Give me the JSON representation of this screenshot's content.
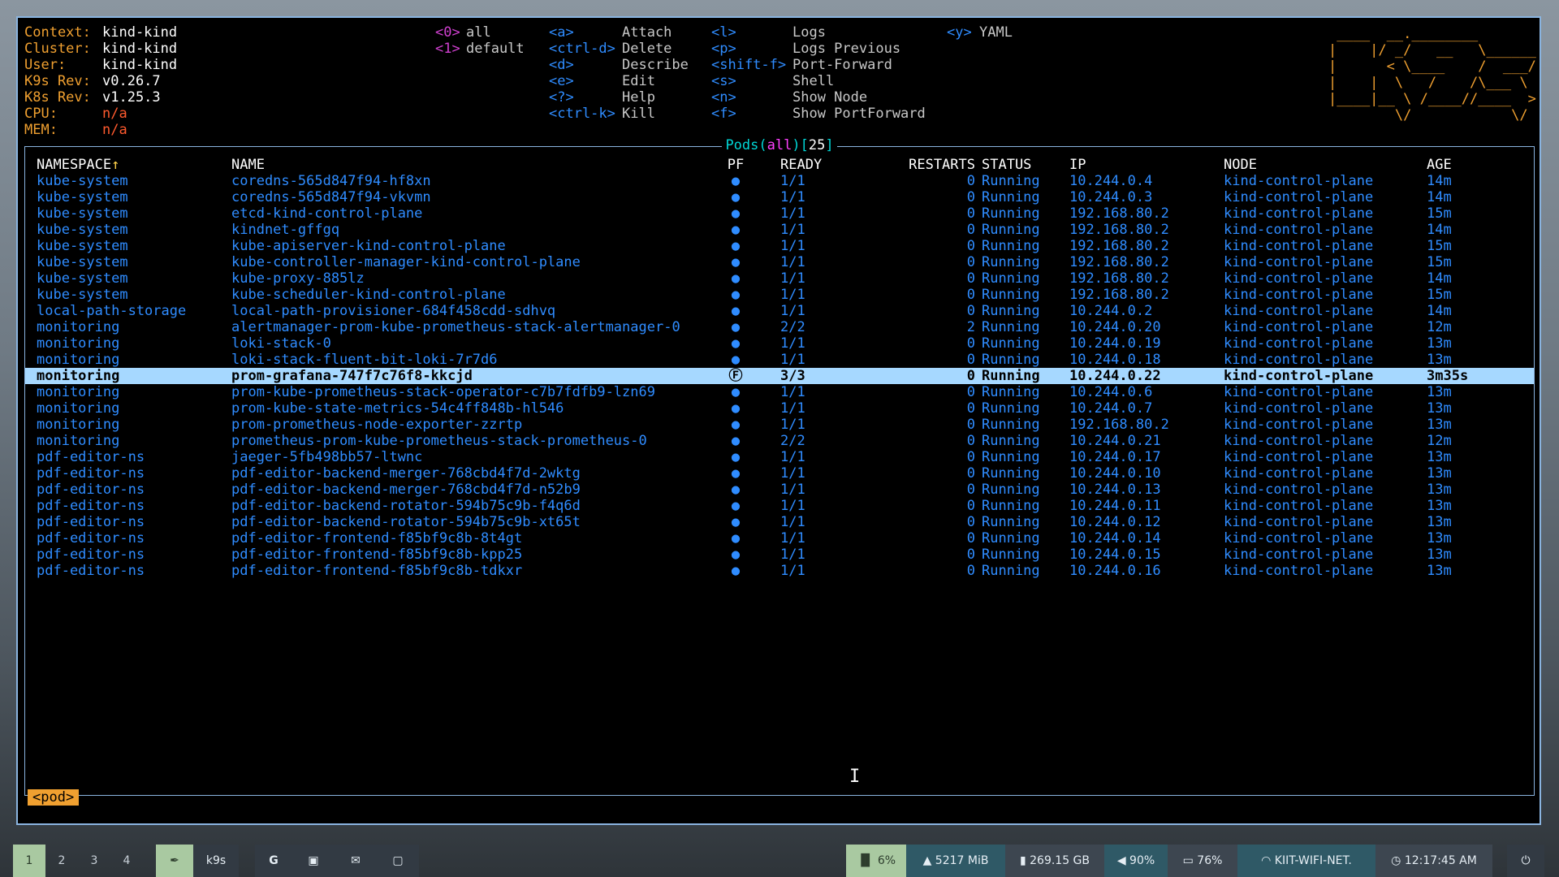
{
  "app": "k9s",
  "info": {
    "context_label": "Context:",
    "context": "kind-kind",
    "cluster_label": "Cluster:",
    "cluster": "kind-kind",
    "user_label": "User:",
    "user": "kind-kind",
    "k9s_rev_label": "K9s Rev:",
    "k9s_rev": "v0.26.7",
    "k8s_rev_label": "K8s Rev:",
    "k8s_rev": "v1.25.3",
    "cpu_label": "CPU:",
    "cpu": "n/a",
    "mem_label": "MEM:",
    "mem": "n/a"
  },
  "namespaces": [
    {
      "key": "<0>",
      "label": "all"
    },
    {
      "key": "<1>",
      "label": "default"
    }
  ],
  "shortcuts_col1": [
    {
      "key": "<a>",
      "label": "Attach"
    },
    {
      "key": "<ctrl-d>",
      "label": "Delete"
    },
    {
      "key": "<d>",
      "label": "Describe"
    },
    {
      "key": "<e>",
      "label": "Edit"
    },
    {
      "key": "<?>",
      "label": "Help"
    },
    {
      "key": "<ctrl-k>",
      "label": "Kill"
    }
  ],
  "shortcuts_col2": [
    {
      "key": "<l>",
      "label": "Logs"
    },
    {
      "key": "<p>",
      "label": "Logs Previous"
    },
    {
      "key": "<shift-f>",
      "label": "Port-Forward"
    },
    {
      "key": "<s>",
      "label": "Shell"
    },
    {
      "key": "<n>",
      "label": "Show Node"
    },
    {
      "key": "<f>",
      "label": "Show PortForward"
    }
  ],
  "shortcuts_col3": [
    {
      "key": "<y>",
      "label": "YAML"
    }
  ],
  "logo_lines": [
    " ____  __.________       ",
    "|    |/ _/   __   \\______",
    "|      < \\____    /  ___/",
    "|    |  \\   /    /\\___ \\ ",
    "|____|__ \\ /____//____  >",
    "        \\/            \\/ "
  ],
  "table": {
    "title_prefix": "Pods(",
    "title_ns": "all",
    "title_mid": ")[",
    "title_count": "25",
    "title_suffix": "]",
    "sort_arrow": "↑",
    "headers": {
      "ns": "NAMESPACE",
      "name": "NAME",
      "pf": "PF",
      "ready": "READY",
      "restarts": "RESTARTS",
      "status": "STATUS",
      "ip": "IP",
      "node": "NODE",
      "age": "AGE"
    },
    "rows": [
      {
        "ns": "kube-system",
        "name": "coredns-565d847f94-hf8xn",
        "pf": "●",
        "ready": "1/1",
        "restarts": "0",
        "status": "Running",
        "ip": "10.244.0.4",
        "node": "kind-control-plane",
        "age": "14m"
      },
      {
        "ns": "kube-system",
        "name": "coredns-565d847f94-vkvmn",
        "pf": "●",
        "ready": "1/1",
        "restarts": "0",
        "status": "Running",
        "ip": "10.244.0.3",
        "node": "kind-control-plane",
        "age": "14m"
      },
      {
        "ns": "kube-system",
        "name": "etcd-kind-control-plane",
        "pf": "●",
        "ready": "1/1",
        "restarts": "0",
        "status": "Running",
        "ip": "192.168.80.2",
        "node": "kind-control-plane",
        "age": "15m"
      },
      {
        "ns": "kube-system",
        "name": "kindnet-gffgq",
        "pf": "●",
        "ready": "1/1",
        "restarts": "0",
        "status": "Running",
        "ip": "192.168.80.2",
        "node": "kind-control-plane",
        "age": "14m"
      },
      {
        "ns": "kube-system",
        "name": "kube-apiserver-kind-control-plane",
        "pf": "●",
        "ready": "1/1",
        "restarts": "0",
        "status": "Running",
        "ip": "192.168.80.2",
        "node": "kind-control-plane",
        "age": "15m"
      },
      {
        "ns": "kube-system",
        "name": "kube-controller-manager-kind-control-plane",
        "pf": "●",
        "ready": "1/1",
        "restarts": "0",
        "status": "Running",
        "ip": "192.168.80.2",
        "node": "kind-control-plane",
        "age": "15m"
      },
      {
        "ns": "kube-system",
        "name": "kube-proxy-885lz",
        "pf": "●",
        "ready": "1/1",
        "restarts": "0",
        "status": "Running",
        "ip": "192.168.80.2",
        "node": "kind-control-plane",
        "age": "14m"
      },
      {
        "ns": "kube-system",
        "name": "kube-scheduler-kind-control-plane",
        "pf": "●",
        "ready": "1/1",
        "restarts": "0",
        "status": "Running",
        "ip": "192.168.80.2",
        "node": "kind-control-plane",
        "age": "15m"
      },
      {
        "ns": "local-path-storage",
        "name": "local-path-provisioner-684f458cdd-sdhvq",
        "pf": "●",
        "ready": "1/1",
        "restarts": "0",
        "status": "Running",
        "ip": "10.244.0.2",
        "node": "kind-control-plane",
        "age": "14m"
      },
      {
        "ns": "monitoring",
        "name": "alertmanager-prom-kube-prometheus-stack-alertmanager-0",
        "pf": "●",
        "ready": "2/2",
        "restarts": "2",
        "status": "Running",
        "ip": "10.244.0.20",
        "node": "kind-control-plane",
        "age": "12m"
      },
      {
        "ns": "monitoring",
        "name": "loki-stack-0",
        "pf": "●",
        "ready": "1/1",
        "restarts": "0",
        "status": "Running",
        "ip": "10.244.0.19",
        "node": "kind-control-plane",
        "age": "13m"
      },
      {
        "ns": "monitoring",
        "name": "loki-stack-fluent-bit-loki-7r7d6",
        "pf": "●",
        "ready": "1/1",
        "restarts": "0",
        "status": "Running",
        "ip": "10.244.0.18",
        "node": "kind-control-plane",
        "age": "13m"
      },
      {
        "ns": "monitoring",
        "name": "prom-grafana-747f7c76f8-kkcjd",
        "pf": "Ⓕ",
        "ready": "3/3",
        "restarts": "0",
        "status": "Running",
        "ip": "10.244.0.22",
        "node": "kind-control-plane",
        "age": "3m35s",
        "selected": true
      },
      {
        "ns": "monitoring",
        "name": "prom-kube-prometheus-stack-operator-c7b7fdfb9-lzn69",
        "pf": "●",
        "ready": "1/1",
        "restarts": "0",
        "status": "Running",
        "ip": "10.244.0.6",
        "node": "kind-control-plane",
        "age": "13m"
      },
      {
        "ns": "monitoring",
        "name": "prom-kube-state-metrics-54c4ff848b-hl546",
        "pf": "●",
        "ready": "1/1",
        "restarts": "0",
        "status": "Running",
        "ip": "10.244.0.7",
        "node": "kind-control-plane",
        "age": "13m"
      },
      {
        "ns": "monitoring",
        "name": "prom-prometheus-node-exporter-zzrtp",
        "pf": "●",
        "ready": "1/1",
        "restarts": "0",
        "status": "Running",
        "ip": "192.168.80.2",
        "node": "kind-control-plane",
        "age": "13m"
      },
      {
        "ns": "monitoring",
        "name": "prometheus-prom-kube-prometheus-stack-prometheus-0",
        "pf": "●",
        "ready": "2/2",
        "restarts": "0",
        "status": "Running",
        "ip": "10.244.0.21",
        "node": "kind-control-plane",
        "age": "12m"
      },
      {
        "ns": "pdf-editor-ns",
        "name": "jaeger-5fb498bb57-ltwnc",
        "pf": "●",
        "ready": "1/1",
        "restarts": "0",
        "status": "Running",
        "ip": "10.244.0.17",
        "node": "kind-control-plane",
        "age": "13m"
      },
      {
        "ns": "pdf-editor-ns",
        "name": "pdf-editor-backend-merger-768cbd4f7d-2wktg",
        "pf": "●",
        "ready": "1/1",
        "restarts": "0",
        "status": "Running",
        "ip": "10.244.0.10",
        "node": "kind-control-plane",
        "age": "13m"
      },
      {
        "ns": "pdf-editor-ns",
        "name": "pdf-editor-backend-merger-768cbd4f7d-n52b9",
        "pf": "●",
        "ready": "1/1",
        "restarts": "0",
        "status": "Running",
        "ip": "10.244.0.13",
        "node": "kind-control-plane",
        "age": "13m"
      },
      {
        "ns": "pdf-editor-ns",
        "name": "pdf-editor-backend-rotator-594b75c9b-f4q6d",
        "pf": "●",
        "ready": "1/1",
        "restarts": "0",
        "status": "Running",
        "ip": "10.244.0.11",
        "node": "kind-control-plane",
        "age": "13m"
      },
      {
        "ns": "pdf-editor-ns",
        "name": "pdf-editor-backend-rotator-594b75c9b-xt65t",
        "pf": "●",
        "ready": "1/1",
        "restarts": "0",
        "status": "Running",
        "ip": "10.244.0.12",
        "node": "kind-control-plane",
        "age": "13m"
      },
      {
        "ns": "pdf-editor-ns",
        "name": "pdf-editor-frontend-f85bf9c8b-8t4gt",
        "pf": "●",
        "ready": "1/1",
        "restarts": "0",
        "status": "Running",
        "ip": "10.244.0.14",
        "node": "kind-control-plane",
        "age": "13m"
      },
      {
        "ns": "pdf-editor-ns",
        "name": "pdf-editor-frontend-f85bf9c8b-kpp25",
        "pf": "●",
        "ready": "1/1",
        "restarts": "0",
        "status": "Running",
        "ip": "10.244.0.15",
        "node": "kind-control-plane",
        "age": "13m"
      },
      {
        "ns": "pdf-editor-ns",
        "name": "pdf-editor-frontend-f85bf9c8b-tdkxr",
        "pf": "●",
        "ready": "1/1",
        "restarts": "0",
        "status": "Running",
        "ip": "10.244.0.16",
        "node": "kind-control-plane",
        "age": "13m"
      }
    ]
  },
  "crumb": "<pod>",
  "taskbar": {
    "workspaces": [
      "1",
      "2",
      "3",
      "4"
    ],
    "active_app": "k9s",
    "app_icons": [
      "feather-icon",
      "google-icon",
      "discord-icon",
      "mail-icon",
      "terminal-icon"
    ],
    "cpu": "6%",
    "memory": "5217 MiB",
    "disk": "269.15 GB",
    "volume": "90%",
    "battery": "76%",
    "wifi": "KIIT-WIFI-NET.",
    "clock": "12:17:45 AM"
  },
  "colors": {
    "accent_blue": "#2f8cff",
    "label_orange": "#f0a030",
    "selection": "#a6d8ff",
    "title_cyan": "#00d6d6",
    "namespace_magenta": "#d040d0",
    "na_red": "#ff5a2e"
  }
}
